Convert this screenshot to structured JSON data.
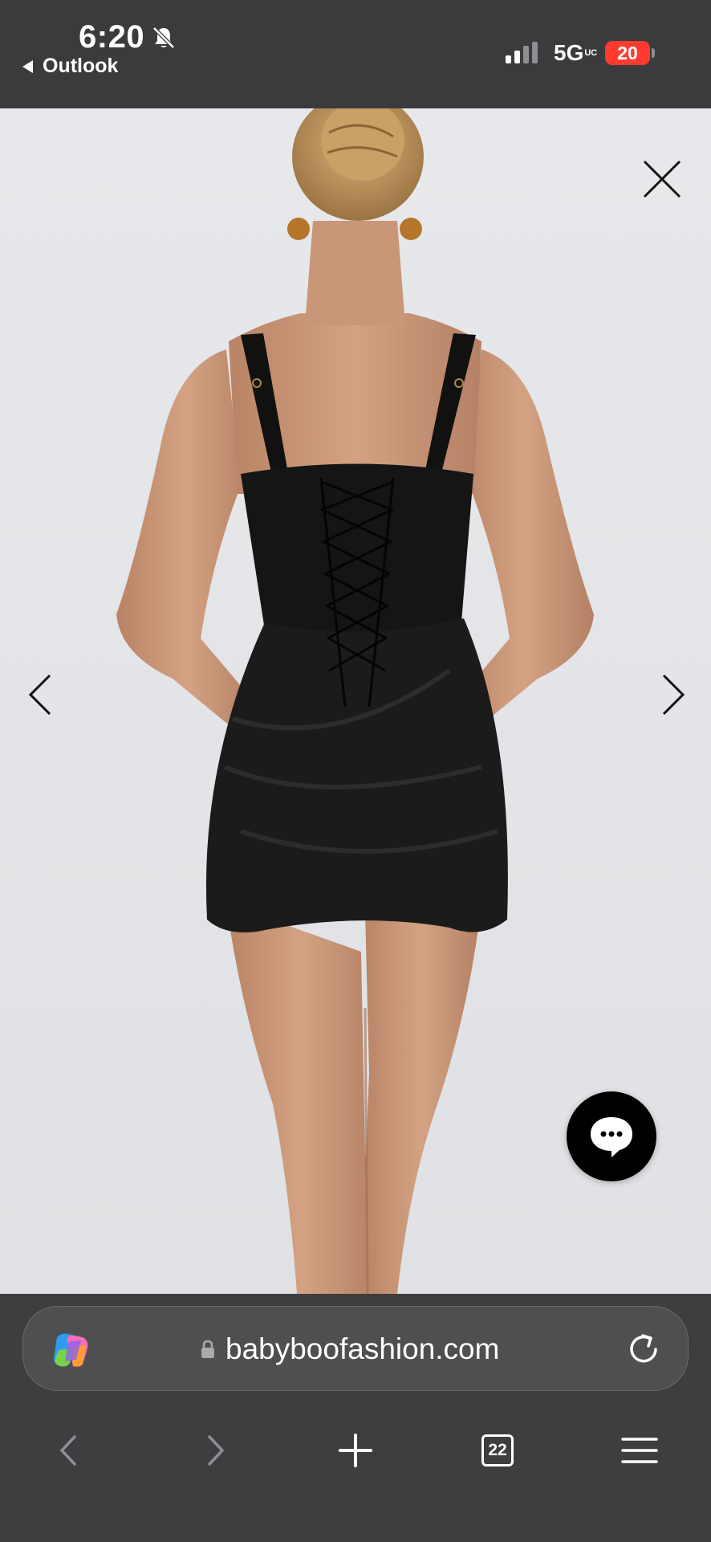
{
  "status_bar": {
    "time": "6:20",
    "back_app_label": "Outlook",
    "network_label": "5G",
    "network_superscript": "UC",
    "battery_level": "20"
  },
  "viewer": {
    "image_alt": "Back view of model wearing black corset mini dress with lace-up back",
    "chat_icon": "chat-bubble-icon"
  },
  "browser": {
    "url": "babyboofashion.com",
    "tabs_count": "22"
  }
}
